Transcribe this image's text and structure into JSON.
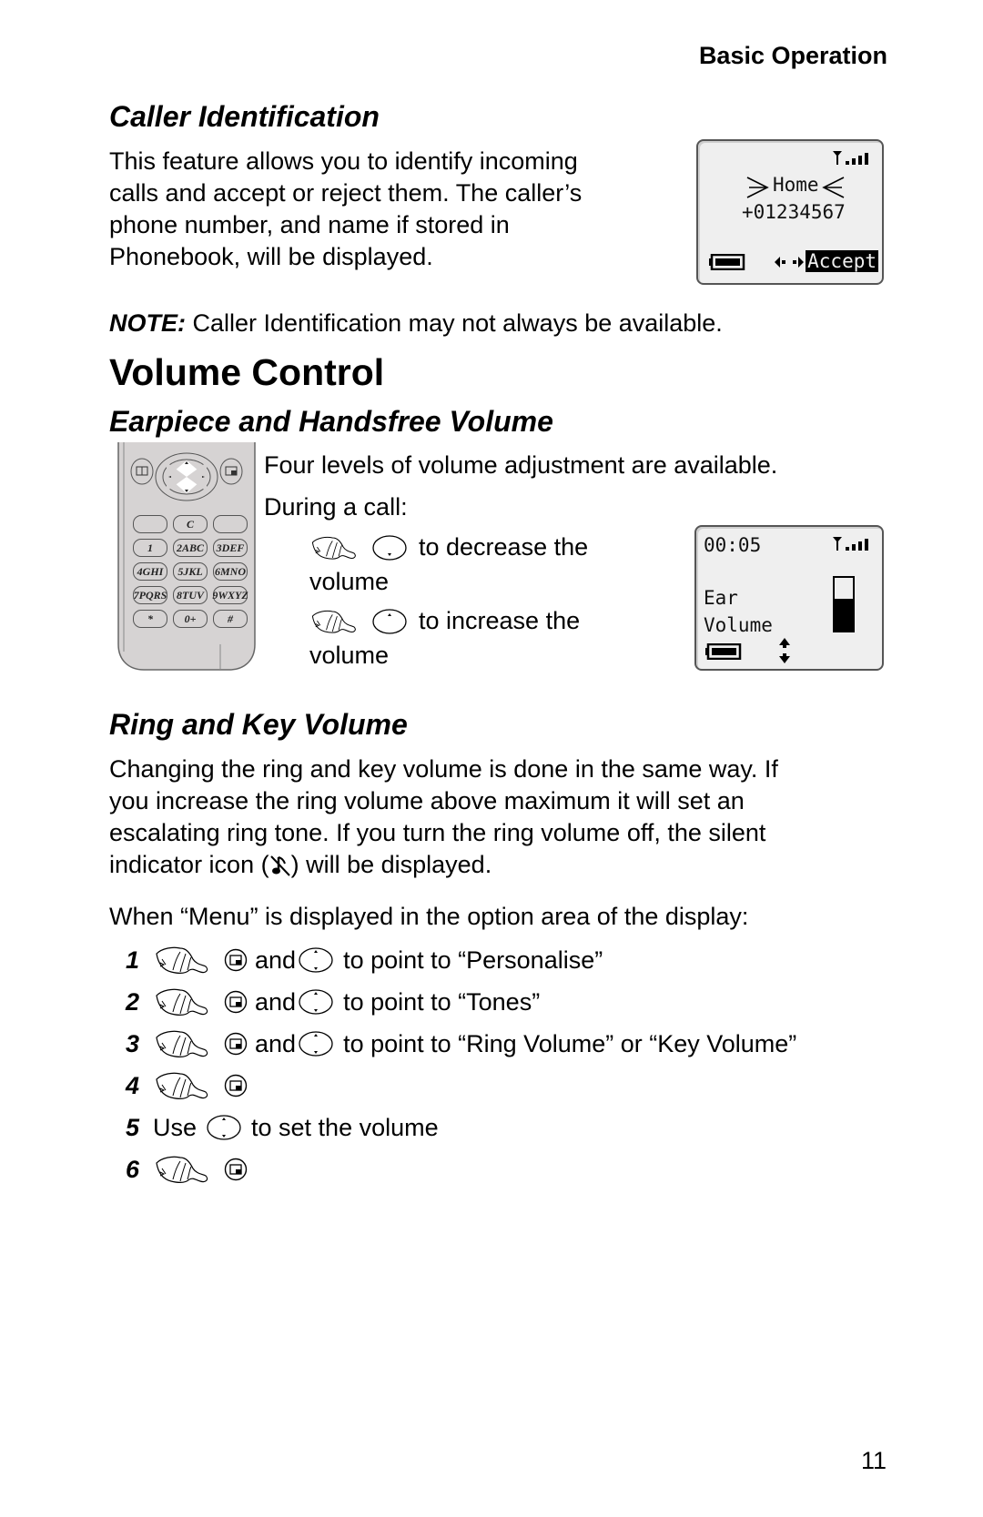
{
  "running_header": "Basic Operation",
  "caller_id": {
    "heading": "Caller Identification",
    "paragraph_lines": [
      "This feature allows you to identify incoming",
      "calls and accept or reject them. The caller’s",
      "phone number, and name if stored in",
      "Phonebook, will be displayed."
    ],
    "screen": {
      "name": "Home",
      "number": "+01234567",
      "softkey": "Accept"
    },
    "note_label": "NOTE:",
    "note_text": " Caller Identification may not always be available."
  },
  "volume_control": {
    "heading": "Volume Control",
    "earpiece": {
      "heading": "Earpiece and Handsfree Volume",
      "intro": "Four levels of volume adjustment are available.",
      "during": "During a call:",
      "decrease_line1": "to decrease the",
      "decrease_line2": "volume",
      "increase_line1": "to increase the",
      "increase_line2": "volume",
      "keypad_keys": [
        [
          "",
          "C",
          ""
        ],
        [
          "1",
          "2ABC",
          "3DEF"
        ],
        [
          "4GHI",
          "5JKL",
          "6MNO"
        ],
        [
          "7PQRS",
          "8TUV",
          "9WXYZ"
        ],
        [
          "*",
          "0+",
          "#"
        ]
      ],
      "screen": {
        "timer": "00:05",
        "label_line1": "Ear",
        "label_line2": "Volume",
        "volume_level": 0.6
      }
    },
    "ring_key": {
      "heading": "Ring and Key Volume",
      "paragraph_lines": [
        "Changing the ring and key volume is done in the same way. If",
        "you increase the ring volume above maximum it will set an",
        "escalating ring tone. If you turn the ring volume off, the silent",
        "indicator icon (",
        ") will be displayed."
      ],
      "menu_intro": "When “Menu” is displayed in the option area of the display:",
      "steps": [
        {
          "num": "1",
          "and": "and",
          "text": "to point to “Personalise”"
        },
        {
          "num": "2",
          "and": "and",
          "text": "to point to “Tones”"
        },
        {
          "num": "3",
          "and": "and",
          "text": "to point to “Ring Volume” or “Key Volume”"
        },
        {
          "num": "4"
        },
        {
          "num": "5",
          "use": "Use",
          "text": "to set the volume"
        },
        {
          "num": "6"
        }
      ]
    }
  },
  "page_number": "11"
}
